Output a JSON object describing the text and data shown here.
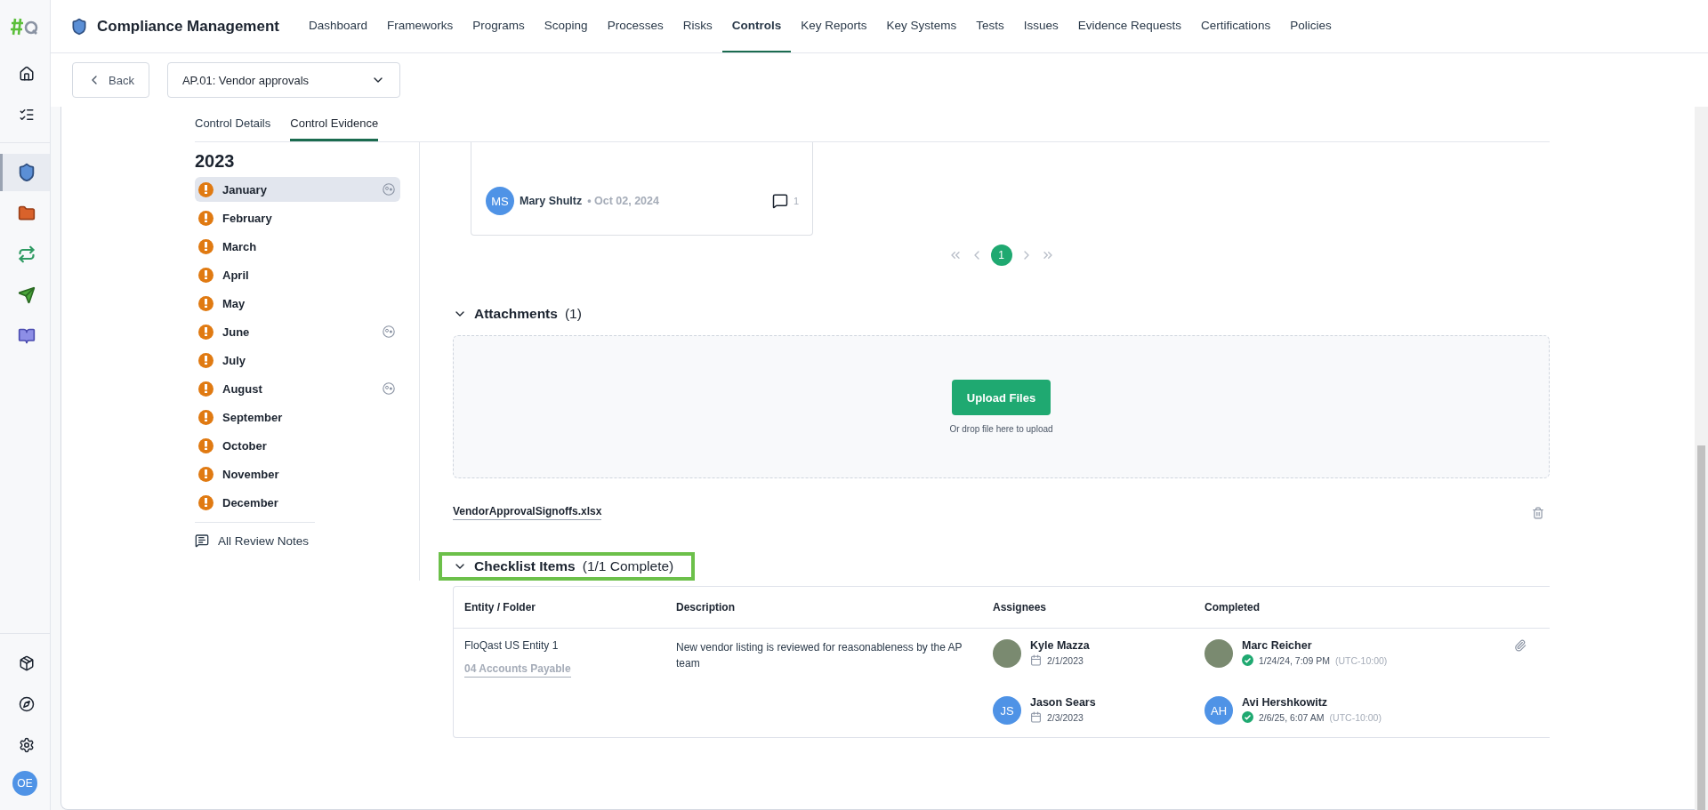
{
  "rail": {
    "top": [
      {
        "kind": "home",
        "selected": false
      },
      {
        "kind": "tasks",
        "selected": false
      }
    ],
    "apps": [
      {
        "kind": "compliance",
        "selected": true
      },
      {
        "kind": "folder",
        "selected": false
      },
      {
        "kind": "sync",
        "selected": false
      },
      {
        "kind": "send",
        "selected": false
      },
      {
        "kind": "book",
        "selected": false
      }
    ],
    "bottom": [
      {
        "kind": "box"
      },
      {
        "kind": "compass"
      },
      {
        "kind": "settings"
      }
    ],
    "user": {
      "initials": "OE"
    }
  },
  "header": {
    "title": "Compliance Management",
    "nav": [
      {
        "label": "Dashboard",
        "selected": false
      },
      {
        "label": "Frameworks",
        "selected": false
      },
      {
        "label": "Programs",
        "selected": false
      },
      {
        "label": "Scoping",
        "selected": false
      },
      {
        "label": "Processes",
        "selected": false
      },
      {
        "label": "Risks",
        "selected": false
      },
      {
        "label": "Controls",
        "selected": true
      },
      {
        "label": "Key Reports",
        "selected": false
      },
      {
        "label": "Key Systems",
        "selected": false
      },
      {
        "label": "Tests",
        "selected": false
      },
      {
        "label": "Issues",
        "selected": false
      },
      {
        "label": "Evidence Requests",
        "selected": false
      },
      {
        "label": "Certifications",
        "selected": false
      },
      {
        "label": "Policies",
        "selected": false
      }
    ]
  },
  "toolbar": {
    "back": "Back",
    "control_select": "AP.01: Vendor approvals"
  },
  "tabs": [
    {
      "label": "Control Details",
      "selected": false
    },
    {
      "label": "Control Evidence",
      "selected": true
    }
  ],
  "periods": {
    "year": "2023",
    "months": [
      {
        "label": "January",
        "flagged": true,
        "has_reviews": true,
        "selected": true
      },
      {
        "label": "February",
        "flagged": true,
        "has_reviews": false,
        "selected": false
      },
      {
        "label": "March",
        "flagged": true,
        "has_reviews": false,
        "selected": false
      },
      {
        "label": "April",
        "flagged": true,
        "has_reviews": false,
        "selected": false
      },
      {
        "label": "May",
        "flagged": true,
        "has_reviews": false,
        "selected": false
      },
      {
        "label": "June",
        "flagged": true,
        "has_reviews": true,
        "selected": false
      },
      {
        "label": "July",
        "flagged": true,
        "has_reviews": false,
        "selected": false
      },
      {
        "label": "August",
        "flagged": true,
        "has_reviews": true,
        "selected": false
      },
      {
        "label": "September",
        "flagged": true,
        "has_reviews": false,
        "selected": false
      },
      {
        "label": "October",
        "flagged": true,
        "has_reviews": false,
        "selected": false
      },
      {
        "label": "November",
        "flagged": true,
        "has_reviews": false,
        "selected": false
      },
      {
        "label": "December",
        "flagged": true,
        "has_reviews": false,
        "selected": false
      }
    ],
    "all_notes": "All Review Notes"
  },
  "evidence_card": {
    "initials": "MS",
    "author": "Mary Shultz",
    "date": "• Oct 02, 2024",
    "comments": "1"
  },
  "pagination": {
    "pages": [
      {
        "label": "1",
        "selected": true
      }
    ]
  },
  "attachments": {
    "title": "Attachments",
    "count": "(1)",
    "expanded": true,
    "upload": "Upload Files",
    "hint": "Or drop file here to upload",
    "files": [
      "VendorApprovalSignoffs.xlsx"
    ]
  },
  "checklist": {
    "title": "Checklist Items",
    "count": "(1/1 Complete)",
    "expanded": true,
    "highlighted": true,
    "columns": [
      "Entity / Folder",
      "Description",
      "Assignees",
      "Completed"
    ],
    "rows": [
      {
        "entity": "FloQast US Entity 1",
        "folder": "04 Accounts Payable",
        "description": "New vendor listing is reviewed for reasonableness by the AP team",
        "assignees": [
          {
            "kind": "photo",
            "name": "Kyle Mazza",
            "date": "2/1/2023"
          },
          {
            "kind": "initials",
            "initials": "JS",
            "name": "Jason Sears",
            "date": "2/3/2023"
          }
        ],
        "completed": [
          {
            "kind": "photo",
            "name": "Marc Reicher",
            "time": "1/24/24, 7:09 PM",
            "timezone": "(UTC-10:00)"
          },
          {
            "kind": "initials",
            "initials": "AH",
            "name": "Avi Hershkowitz",
            "time": "2/6/25, 6:07 AM",
            "timezone": "(UTC-10:00)"
          }
        ],
        "has_attachment": true
      }
    ]
  }
}
